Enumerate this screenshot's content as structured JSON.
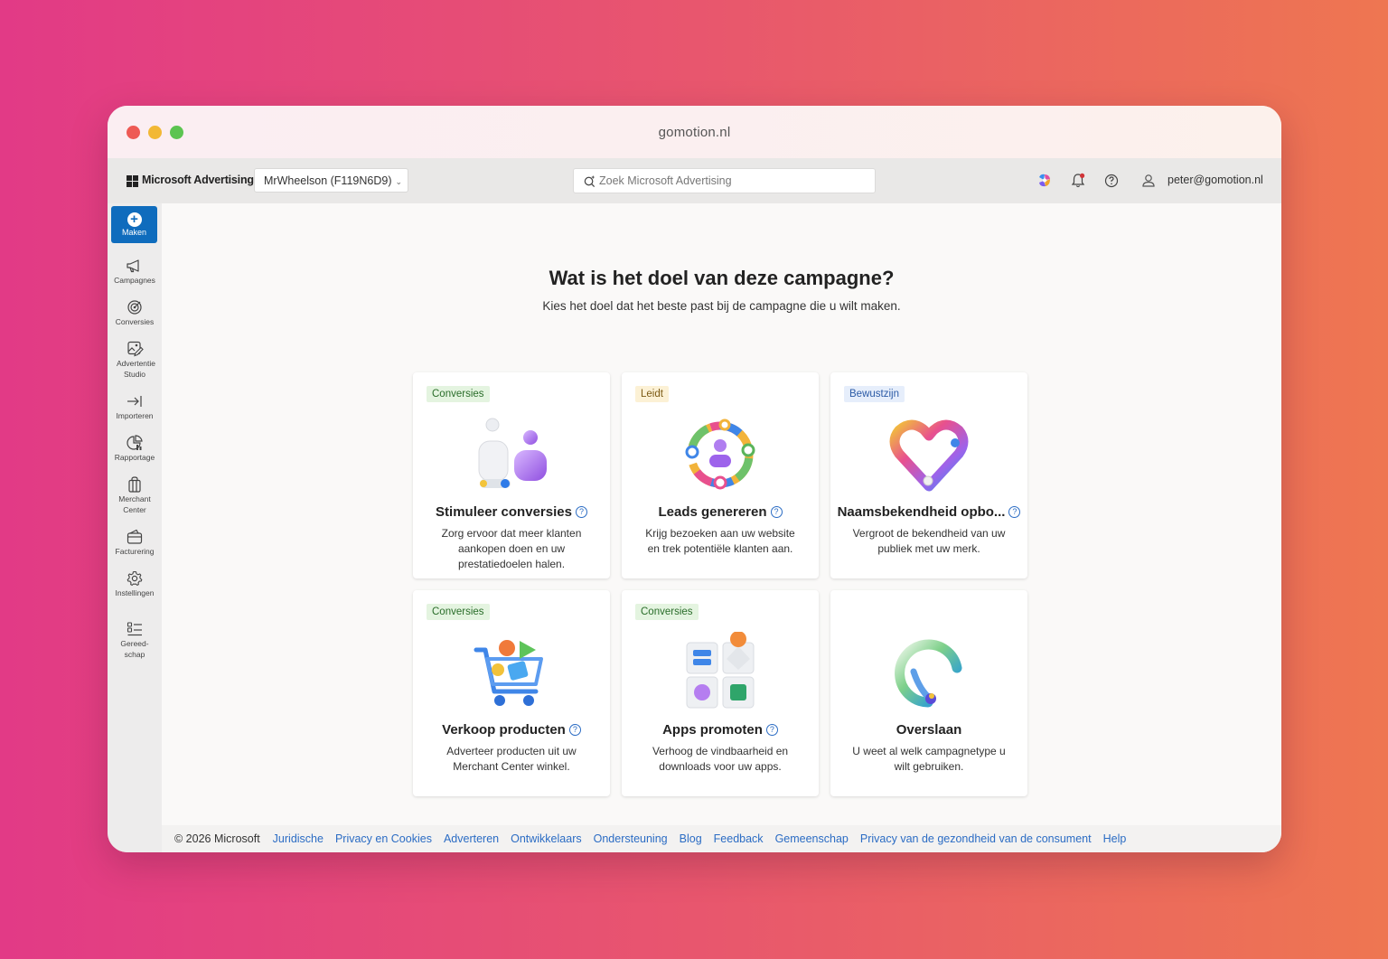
{
  "window": {
    "title": "gomotion.nl"
  },
  "topbar": {
    "brand": "Microsoft Advertising",
    "account": "MrWheelson (F119N6D9)",
    "search_placeholder": "Zoek Microsoft Advertising",
    "user_email": "peter@gomotion.nl"
  },
  "sidebar": {
    "create": "Maken",
    "items": [
      {
        "label": "Campagnes",
        "icon": "megaphone-icon"
      },
      {
        "label": "Conversies",
        "icon": "target-icon"
      },
      {
        "label": "Advertentie Studio",
        "icon": "image-edit-icon"
      },
      {
        "label": "Importeren",
        "icon": "import-arrow-icon"
      },
      {
        "label": "Rapportage",
        "icon": "chart-icon"
      },
      {
        "label": "Merchant Center",
        "icon": "shopping-bag-icon"
      },
      {
        "label": "Facturering",
        "icon": "wallet-icon"
      },
      {
        "label": "Instellingen",
        "icon": "gear-icon"
      },
      {
        "label": "Gereed-schap",
        "icon": "tools-list-icon"
      }
    ]
  },
  "main": {
    "heading": "Wat is het doel van deze campagne?",
    "subheading": "Kies het doel dat het beste past bij de campagne die u wilt maken.",
    "cards": [
      {
        "tag": "Conversies",
        "title": "Stimuleer conversies",
        "help": "?",
        "description": "Zorg ervoor dat meer klanten aankopen doen en uw prestatiedoelen halen."
      },
      {
        "tag": "Leidt",
        "title": "Leads genereren",
        "help": "?",
        "description": "Krijg bezoeken aan uw website en trek potentiële klanten aan."
      },
      {
        "tag": "Bewustzijn",
        "title": "Naamsbekendheid opbo...",
        "help": "?",
        "description": "Vergroot de bekendheid van uw publiek met uw merk."
      },
      {
        "tag": "Conversies",
        "title": "Verkoop producten",
        "help": "?",
        "description": "Adverteer producten uit uw Merchant Center winkel."
      },
      {
        "tag": "Conversies",
        "title": "Apps promoten",
        "help": "?",
        "description": "Verhoog de vindbaarheid en downloads voor uw apps."
      },
      {
        "tag": "",
        "title": "Overslaan",
        "help": "",
        "description": "U weet al welk campagnetype u wilt gebruiken."
      }
    ]
  },
  "footer": {
    "copyright": "© 2026 Microsoft",
    "links": [
      "Juridische",
      "Privacy en Cookies",
      "Adverteren",
      "Ontwikkelaars",
      "Ondersteuning",
      "Blog",
      "Feedback",
      "Gemeenschap",
      "Privacy van de gezondheid van de consument",
      "Help"
    ]
  },
  "colors": {
    "accent": "#0f6cbd",
    "link": "#2b6cc4",
    "background_gradient_start": "#e23a86",
    "background_gradient_end": "#ee7651"
  }
}
